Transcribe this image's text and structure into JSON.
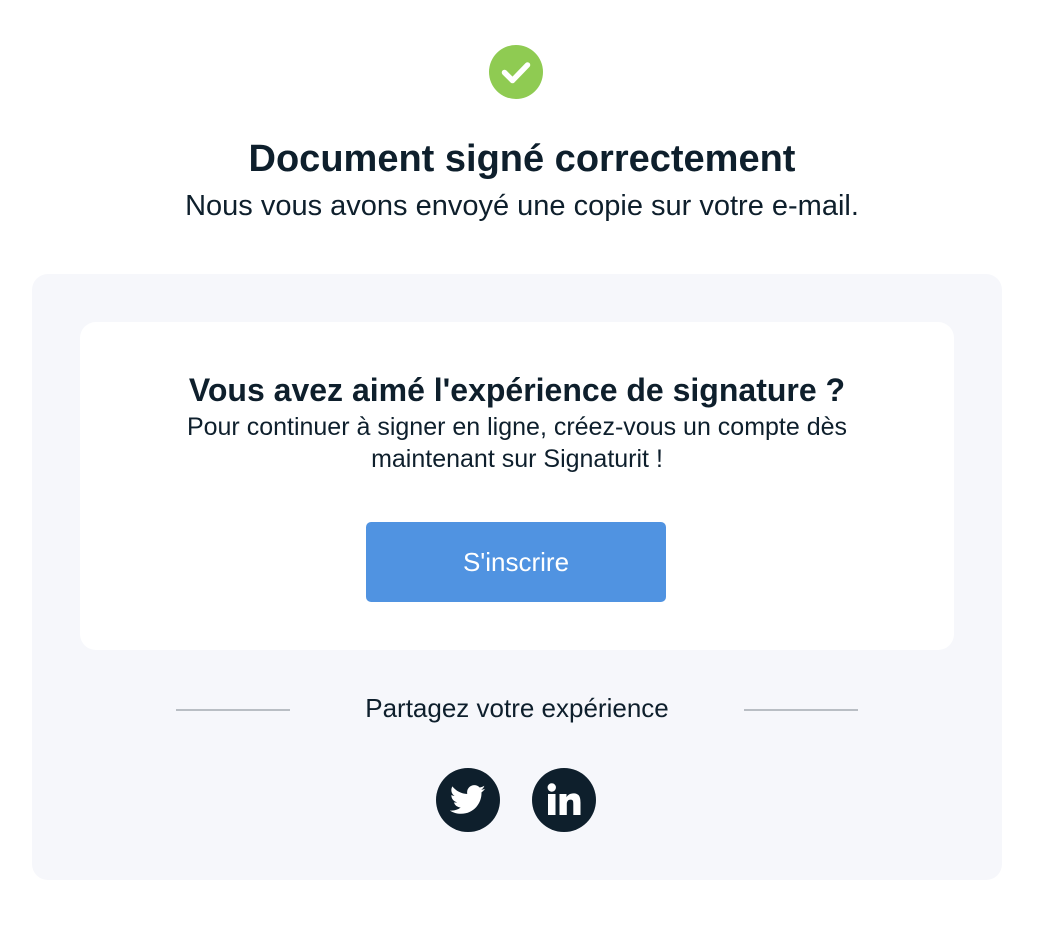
{
  "colors": {
    "success": "#8fcb52",
    "text": "#0e1f2c",
    "panel_background": "#f6f7fb",
    "card_background": "#ffffff",
    "button": "#5093e1",
    "button_text": "#ffffff",
    "divider": "#b9bec4",
    "social_background": "#0e1f2c"
  },
  "icons": {
    "success": "check-circle-icon",
    "twitter": "twitter-icon",
    "linkedin": "linkedin-icon"
  },
  "header": {
    "title": "Document signé correctement",
    "subtitle": "Nous vous avons envoyé une copie sur votre e-mail."
  },
  "promo": {
    "title": "Vous avez aimé l'expérience de signature ?",
    "text": "Pour continuer à signer en ligne, créez-vous un compte dès maintenant sur Signaturit !",
    "button_label": "S'inscrire"
  },
  "share": {
    "label": "Partagez votre expérience",
    "networks": [
      "Twitter",
      "LinkedIn"
    ]
  }
}
